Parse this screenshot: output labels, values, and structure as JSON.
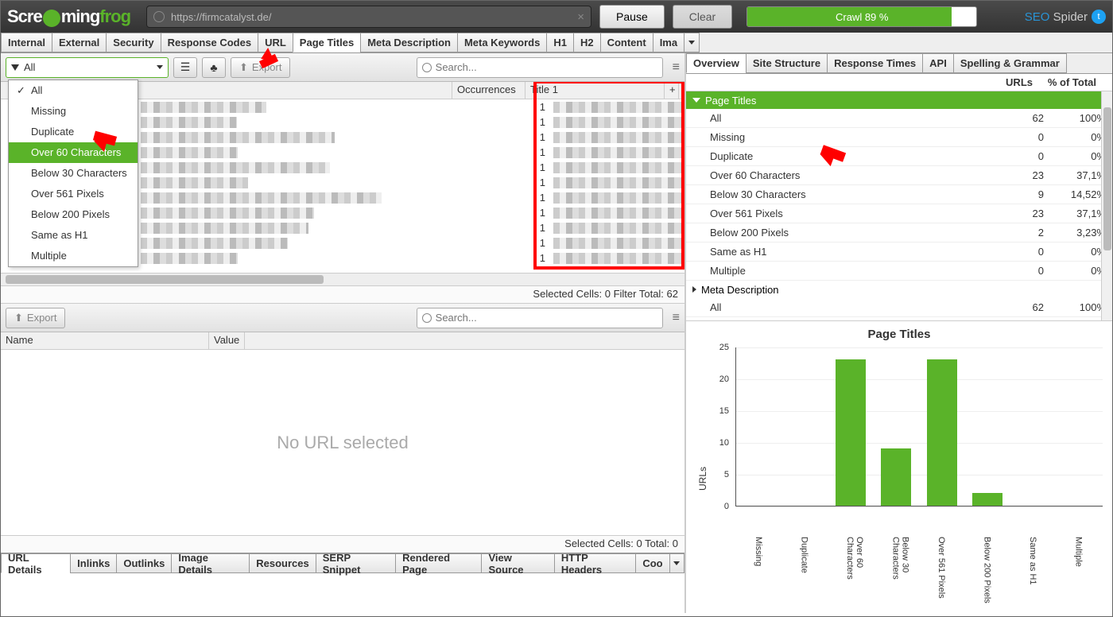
{
  "topbar": {
    "logo_pre": "Scre",
    "logo_mid": "ming",
    "logo_frog": "frog",
    "url": "https://firmcatalyst.de/",
    "pause": "Pause",
    "clear": "Clear",
    "crawl": "Crawl 89 %",
    "seo": "SEO",
    "spider": " Spider"
  },
  "tabs": [
    "Internal",
    "External",
    "Security",
    "Response Codes",
    "URL",
    "Page Titles",
    "Meta Description",
    "Meta Keywords",
    "H1",
    "H2",
    "Content",
    "Ima"
  ],
  "active_tab": 5,
  "filter": {
    "label": "All",
    "export": "Export",
    "search": "Search..."
  },
  "dropdown": [
    "All",
    "Missing",
    "Duplicate",
    "Over 60 Characters",
    "Below 30 Characters",
    "Over 561 Pixels",
    "Below 200 Pixels",
    "Same as H1",
    "Multiple"
  ],
  "dd_selected": 3,
  "grid": {
    "occ": "Occurrences",
    "title1": "Title 1",
    "occ_vals": [
      "1",
      "1",
      "1",
      "1",
      "1",
      "1",
      "1",
      "1",
      "1",
      "1",
      "1"
    ]
  },
  "status1": "Selected Cells:  0  Filter Total:  62",
  "lower": {
    "export": "Export",
    "search": "Search...",
    "name": "Name",
    "value": "Value",
    "no_url": "No URL selected",
    "status2": "Selected Cells:  0  Total:  0"
  },
  "bottom_tabs": [
    "URL Details",
    "Inlinks",
    "Outlinks",
    "Image Details",
    "Resources",
    "SERP Snippet",
    "Rendered Page",
    "View Source",
    "HTTP Headers",
    "Coo"
  ],
  "r_tabs": [
    "Overview",
    "Site Structure",
    "Response Times",
    "API",
    "Spelling & Grammar"
  ],
  "r_header": {
    "urls": "URLs",
    "pct": "% of Total"
  },
  "r_sec1": "Page Titles",
  "r_sec2": "Meta Description",
  "r_rows": [
    {
      "name": "All",
      "urls": "62",
      "pct": "100%"
    },
    {
      "name": "Missing",
      "urls": "0",
      "pct": "0%"
    },
    {
      "name": "Duplicate",
      "urls": "0",
      "pct": "0%"
    },
    {
      "name": "Over 60 Characters",
      "urls": "23",
      "pct": "37,1%"
    },
    {
      "name": "Below 30 Characters",
      "urls": "9",
      "pct": "14,52%"
    },
    {
      "name": "Over 561 Pixels",
      "urls": "23",
      "pct": "37,1%"
    },
    {
      "name": "Below 200 Pixels",
      "urls": "2",
      "pct": "3,23%"
    },
    {
      "name": "Same as H1",
      "urls": "0",
      "pct": "0%"
    },
    {
      "name": "Multiple",
      "urls": "0",
      "pct": "0%"
    }
  ],
  "r_rows2": [
    {
      "name": "All",
      "urls": "62",
      "pct": "100%"
    }
  ],
  "chart_data": {
    "type": "bar",
    "title": "Page Titles",
    "ylabel": "URLs",
    "ylim": [
      0,
      25
    ],
    "yticks": [
      0,
      5,
      10,
      15,
      20,
      25
    ],
    "categories": [
      "Missing",
      "Duplicate",
      "Over 60 Characters",
      "Below 30 Characters",
      "Over 561 Pixels",
      "Below 200 Pixels",
      "Same as H1",
      "Multiple"
    ],
    "values": [
      0,
      0,
      23,
      9,
      23,
      2,
      0,
      0
    ]
  }
}
